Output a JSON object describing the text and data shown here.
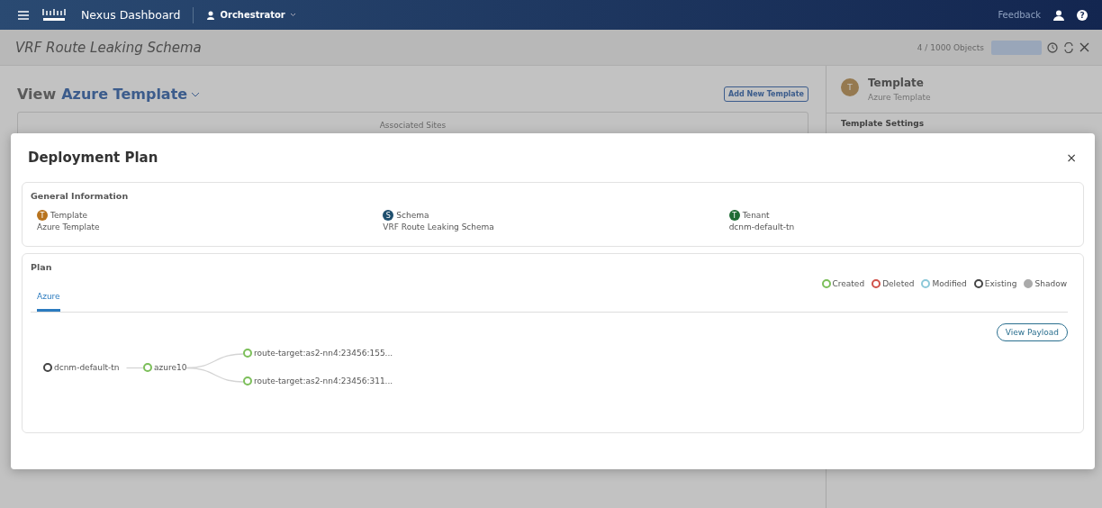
{
  "header": {
    "brand": "Nexus Dashboard",
    "app": "Orchestrator",
    "feedback": "Feedback",
    "help": "?"
  },
  "page": {
    "title": "VRF Route Leaking Schema",
    "objects": "4 / 1000 Objects",
    "view_label": "View",
    "view_value": "Azure Template",
    "add_button": "Add New Template",
    "associated_sites": "Associated Sites"
  },
  "side_panel": {
    "avatar": "T",
    "title": "Template",
    "subtitle": "Azure Template",
    "section": "Template Settings"
  },
  "modal": {
    "title": "Deployment Plan",
    "close": "×",
    "general": {
      "heading": "General Information",
      "items": [
        {
          "badge": "T",
          "label": "Template",
          "value": "Azure Template",
          "color": "#b8731e"
        },
        {
          "badge": "S",
          "label": "Schema",
          "value": "VRF Route Leaking Schema",
          "color": "#1f4f6e"
        },
        {
          "badge": "T",
          "label": "Tenant",
          "value": "dcnm-default-tn",
          "color": "#1f6b34"
        }
      ]
    },
    "plan": {
      "heading": "Plan",
      "tabs": [
        {
          "label": "Azure",
          "selected": true
        }
      ],
      "legend": [
        {
          "kind": "created",
          "label": "Created",
          "color": "#7cbf5a"
        },
        {
          "kind": "deleted",
          "label": "Deleted",
          "color": "#d0524a"
        },
        {
          "kind": "modified",
          "label": "Modified",
          "color": "#8cc8d8"
        },
        {
          "kind": "existing",
          "label": "Existing",
          "color": "#444444"
        },
        {
          "kind": "shadow",
          "label": "Shadow",
          "color": "#aaaaaa"
        }
      ],
      "view_payload": "View Payload",
      "tree": {
        "label": "dcnm-default-tn",
        "color": "#444444",
        "children": [
          {
            "label": "azure10",
            "color": "#7cbf5a",
            "children": [
              {
                "label": "route-target:as2-nn4:23456:155...",
                "color": "#7cbf5a"
              },
              {
                "label": "route-target:as2-nn4:23456:311...",
                "color": "#7cbf5a"
              }
            ]
          }
        ]
      }
    }
  }
}
